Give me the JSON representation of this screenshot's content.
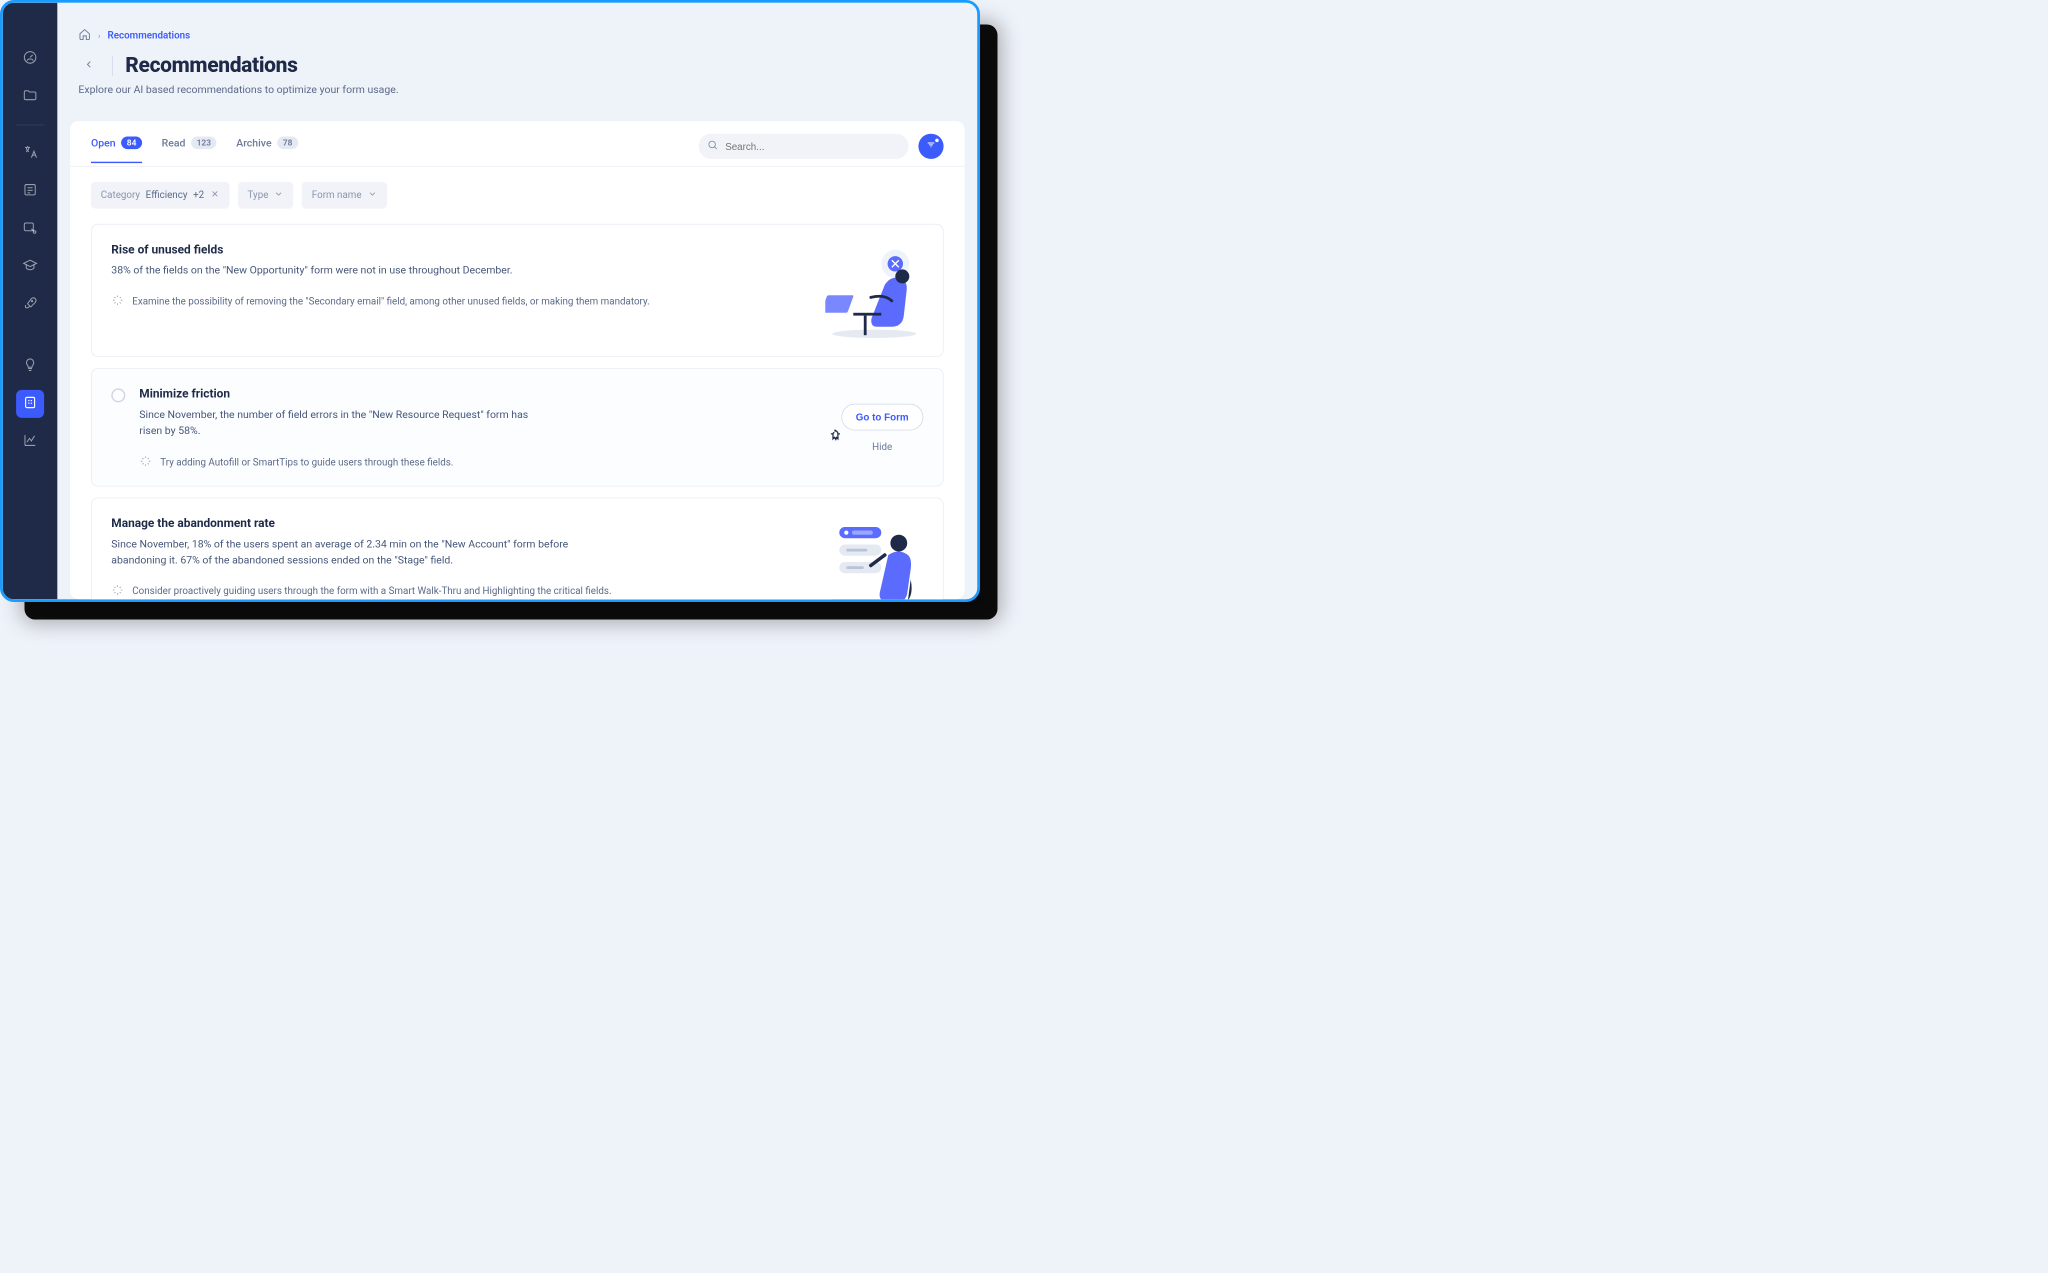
{
  "breadcrumb": {
    "current": "Recommendations"
  },
  "header": {
    "title": "Recommendations",
    "subtitle": "Explore our AI based recommendations to optimize your form usage."
  },
  "tabs": [
    {
      "label": "Open",
      "count": "84",
      "active": true
    },
    {
      "label": "Read",
      "count": "123",
      "active": false
    },
    {
      "label": "Archive",
      "count": "78",
      "active": false
    }
  ],
  "search": {
    "placeholder": "Search..."
  },
  "filters": {
    "category": {
      "label": "Category",
      "value": "Efficiency",
      "extra": "+2"
    },
    "type": {
      "label": "Type"
    },
    "form": {
      "label": "Form name"
    }
  },
  "actions": {
    "goToForm": "Go to Form",
    "hide": "Hide"
  },
  "cards": [
    {
      "title": "Rise of unused fields",
      "description": "38% of the fields on the \"New Opportunity\" form were not in use throughout December.",
      "suggestion": "Examine the possibility of removing the \"Secondary email\" field, among other unused fields, or making them mandatory."
    },
    {
      "title": "Minimize friction",
      "description": "Since November, the number of field errors in the \"New Resource Request\" form has risen by 58%.",
      "suggestion": "Try adding Autofill or SmartTips to guide users through these fields."
    },
    {
      "title": "Manage the abandonment rate",
      "description": "Since November, 18% of the users spent an average of 2.34 min on the \"New Account\" form before abandoning it. 67% of the abandoned sessions ended on the \"Stage\" field.",
      "suggestion": "Consider proactively guiding users through the form with a Smart Walk-Thru and Highlighting the critical fields."
    }
  ],
  "colors": {
    "primary": "#3b5bfd",
    "dark": "#1e2a47",
    "grayText": "#5b6a89"
  }
}
